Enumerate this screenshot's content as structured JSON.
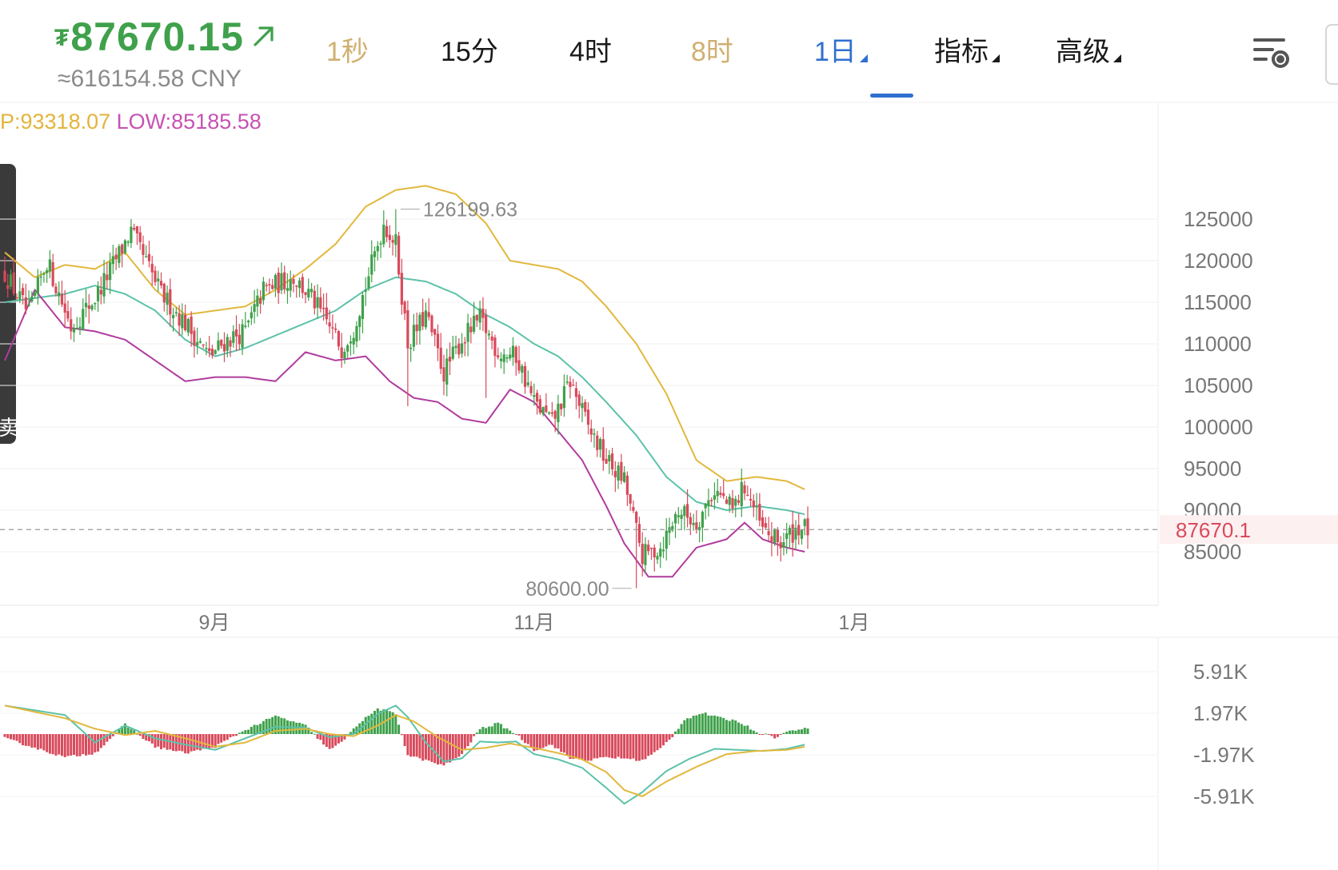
{
  "header": {
    "currency_symbol": "₮",
    "last_price": "87670.15",
    "price_cny": "≈616154.58 CNY",
    "tabs": [
      {
        "label": "1秒",
        "state": "dim",
        "caret": false
      },
      {
        "label": "15分",
        "state": "normal",
        "caret": false
      },
      {
        "label": "4时",
        "state": "normal",
        "caret": false
      },
      {
        "label": "8时",
        "state": "dim",
        "caret": false
      },
      {
        "label": "1日",
        "state": "active",
        "caret": true
      },
      {
        "label": "指标",
        "state": "normal",
        "caret": true
      },
      {
        "label": "高级",
        "state": "normal",
        "caret": true
      }
    ],
    "settings_icon": "chart-settings-icon"
  },
  "hilo": {
    "high": "P:93318.07",
    "low": "LOW:85185.58"
  },
  "side_tab": {
    "label": "卖"
  },
  "colors": {
    "up": "#3fa14b",
    "down": "#d84a5b",
    "mid_band": "#5cc2a9",
    "upper_band": "#e2b83d",
    "lower_band": "#b13c9e",
    "active_tab": "#2f6fd0",
    "dim_tab": "#d0b070",
    "text": "#1a1a1a",
    "axis_text": "#888888",
    "high_text": "#e3b43c",
    "low_text": "#c652b3",
    "current_price_text": "#d84a5b",
    "macd_dif": "#5cc2a9",
    "macd_dea": "#e2b83d"
  },
  "chart_data": [
    {
      "type": "candlestick",
      "title": "",
      "y_axis_ticks": [
        125000,
        120000,
        115000,
        110000,
        105000,
        100000,
        95000,
        90000,
        85000
      ],
      "y_axis_tick_labels": [
        "125000",
        "120000",
        "115000",
        "110000",
        "105000",
        "100000",
        "95000",
        "90000",
        "85000"
      ],
      "ylim": [
        80000,
        132000
      ],
      "x_axis_labels": [
        "9月",
        "11月",
        "1月"
      ],
      "current_price": 87670.15,
      "current_price_label": "87670.1",
      "max_annotation": {
        "value": 126199.63,
        "label": "126199.63"
      },
      "min_annotation": {
        "value": 80600.0,
        "label": "80600.00"
      },
      "overlay": "bollinger bands (upper / middle / lower)",
      "close_path": [
        [
          0,
          118500
        ],
        [
          8,
          113500
        ],
        [
          14,
          120000
        ],
        [
          22,
          112000
        ],
        [
          30,
          115500
        ],
        [
          42,
          123500
        ],
        [
          52,
          116000
        ],
        [
          60,
          112500
        ],
        [
          68,
          108500
        ],
        [
          74,
          110500
        ],
        [
          80,
          111500
        ],
        [
          86,
          116500
        ],
        [
          96,
          118000
        ],
        [
          102,
          115500
        ],
        [
          108,
          112000
        ],
        [
          112,
          109500
        ],
        [
          116,
          112000
        ],
        [
          126,
          124500
        ],
        [
          130,
          122000
        ],
        [
          134,
          110000
        ],
        [
          140,
          113500
        ],
        [
          146,
          106500
        ],
        [
          152,
          110500
        ],
        [
          158,
          113000
        ],
        [
          164,
          109000
        ],
        [
          170,
          108500
        ],
        [
          176,
          103000
        ],
        [
          182,
          100500
        ],
        [
          188,
          105500
        ],
        [
          194,
          100000
        ],
        [
          200,
          96000
        ],
        [
          206,
          93500
        ],
        [
          212,
          84500
        ],
        [
          218,
          85500
        ],
        [
          224,
          90000
        ],
        [
          230,
          88500
        ],
        [
          236,
          92500
        ],
        [
          242,
          90000
        ],
        [
          246,
          93000
        ],
        [
          252,
          87500
        ],
        [
          258,
          86000
        ],
        [
          264,
          88000
        ],
        [
          267,
          87670
        ]
      ],
      "bollinger_upper_path": [
        [
          0,
          121000
        ],
        [
          10,
          118000
        ],
        [
          20,
          119500
        ],
        [
          30,
          119000
        ],
        [
          40,
          121000
        ],
        [
          50,
          116500
        ],
        [
          60,
          113500
        ],
        [
          70,
          114000
        ],
        [
          80,
          114500
        ],
        [
          90,
          116500
        ],
        [
          100,
          119000
        ],
        [
          110,
          122000
        ],
        [
          120,
          126500
        ],
        [
          130,
          128500
        ],
        [
          140,
          129000
        ],
        [
          150,
          128000
        ],
        [
          160,
          124500
        ],
        [
          168,
          120000
        ],
        [
          176,
          119500
        ],
        [
          184,
          119000
        ],
        [
          192,
          117500
        ],
        [
          200,
          114500
        ],
        [
          210,
          110000
        ],
        [
          220,
          104000
        ],
        [
          230,
          96000
        ],
        [
          240,
          93500
        ],
        [
          250,
          94000
        ],
        [
          260,
          93500
        ],
        [
          266,
          92500
        ]
      ],
      "bollinger_mid_path": [
        [
          0,
          115000
        ],
        [
          10,
          115500
        ],
        [
          20,
          116000
        ],
        [
          30,
          117000
        ],
        [
          40,
          116000
        ],
        [
          50,
          114000
        ],
        [
          60,
          110500
        ],
        [
          70,
          108500
        ],
        [
          80,
          109500
        ],
        [
          90,
          111000
        ],
        [
          100,
          112500
        ],
        [
          110,
          114000
        ],
        [
          120,
          116500
        ],
        [
          130,
          118000
        ],
        [
          140,
          117500
        ],
        [
          150,
          116000
        ],
        [
          160,
          113500
        ],
        [
          168,
          112000
        ],
        [
          176,
          110000
        ],
        [
          184,
          108500
        ],
        [
          192,
          106000
        ],
        [
          200,
          103000
        ],
        [
          210,
          99000
        ],
        [
          220,
          94000
        ],
        [
          230,
          91000
        ],
        [
          240,
          90000
        ],
        [
          250,
          90500
        ],
        [
          260,
          90000
        ],
        [
          266,
          89500
        ]
      ],
      "bollinger_lower_path": [
        [
          0,
          108000
        ],
        [
          10,
          116500
        ],
        [
          20,
          112000
        ],
        [
          30,
          111500
        ],
        [
          40,
          110500
        ],
        [
          50,
          108000
        ],
        [
          60,
          105500
        ],
        [
          70,
          106000
        ],
        [
          80,
          106000
        ],
        [
          90,
          105500
        ],
        [
          100,
          109000
        ],
        [
          110,
          108000
        ],
        [
          120,
          108500
        ],
        [
          128,
          105500
        ],
        [
          136,
          103500
        ],
        [
          144,
          103000
        ],
        [
          152,
          101000
        ],
        [
          160,
          100500
        ],
        [
          168,
          104500
        ],
        [
          176,
          103000
        ],
        [
          184,
          99500
        ],
        [
          192,
          96000
        ],
        [
          200,
          90500
        ],
        [
          206,
          86000
        ],
        [
          214,
          82000
        ],
        [
          222,
          82000
        ],
        [
          230,
          85500
        ],
        [
          240,
          86500
        ],
        [
          246,
          88500
        ],
        [
          252,
          86500
        ],
        [
          260,
          85500
        ],
        [
          266,
          85000
        ]
      ]
    },
    {
      "type": "bar",
      "title": "",
      "y_axis_ticks": [
        5910,
        1970,
        -1970,
        -5910
      ],
      "y_axis_tick_labels": [
        "5.91K",
        "1.97K",
        "-1.97K",
        "-5.91K"
      ],
      "ylim": [
        -7500,
        7500
      ],
      "histogram_path": [
        [
          0,
          -400
        ],
        [
          20,
          -2200
        ],
        [
          30,
          -1800
        ],
        [
          40,
          900
        ],
        [
          50,
          -1200
        ],
        [
          60,
          -1800
        ],
        [
          70,
          -1200
        ],
        [
          80,
          400
        ],
        [
          90,
          1700
        ],
        [
          100,
          800
        ],
        [
          108,
          -1500
        ],
        [
          112,
          -800
        ],
        [
          116,
          600
        ],
        [
          124,
          2400
        ],
        [
          130,
          1900
        ],
        [
          134,
          -2000
        ],
        [
          140,
          -2500
        ],
        [
          146,
          -3000
        ],
        [
          152,
          -1900
        ],
        [
          158,
          500
        ],
        [
          164,
          1000
        ],
        [
          170,
          0
        ],
        [
          176,
          -1500
        ],
        [
          182,
          -1000
        ],
        [
          188,
          -2300
        ],
        [
          194,
          -2500
        ],
        [
          200,
          -2200
        ],
        [
          206,
          -2300
        ],
        [
          212,
          -2500
        ],
        [
          218,
          -1400
        ],
        [
          222,
          -200
        ],
        [
          226,
          1400
        ],
        [
          232,
          2000
        ],
        [
          238,
          1500
        ],
        [
          244,
          1200
        ],
        [
          250,
          200
        ],
        [
          256,
          -300
        ],
        [
          262,
          400
        ],
        [
          267,
          500
        ]
      ],
      "dif_path": [
        [
          0,
          2700
        ],
        [
          20,
          1800
        ],
        [
          30,
          -800
        ],
        [
          40,
          800
        ],
        [
          50,
          -400
        ],
        [
          60,
          -1000
        ],
        [
          70,
          -1500
        ],
        [
          80,
          -400
        ],
        [
          90,
          700
        ],
        [
          100,
          600
        ],
        [
          108,
          -300
        ],
        [
          116,
          0
        ],
        [
          124,
          1900
        ],
        [
          130,
          2700
        ],
        [
          134,
          1600
        ],
        [
          140,
          -800
        ],
        [
          146,
          -2600
        ],
        [
          152,
          -2300
        ],
        [
          158,
          -700
        ],
        [
          164,
          -800
        ],
        [
          170,
          -700
        ],
        [
          176,
          -1900
        ],
        [
          184,
          -2400
        ],
        [
          192,
          -3200
        ],
        [
          200,
          -5100
        ],
        [
          206,
          -6600
        ],
        [
          212,
          -5500
        ],
        [
          220,
          -3500
        ],
        [
          228,
          -2300
        ],
        [
          236,
          -1400
        ],
        [
          244,
          -1500
        ],
        [
          252,
          -1600
        ],
        [
          260,
          -1400
        ],
        [
          266,
          -1000
        ]
      ],
      "dea_path": [
        [
          0,
          2700
        ],
        [
          20,
          1500
        ],
        [
          30,
          500
        ],
        [
          40,
          -100
        ],
        [
          50,
          300
        ],
        [
          60,
          -400
        ],
        [
          70,
          -1200
        ],
        [
          80,
          -800
        ],
        [
          90,
          300
        ],
        [
          100,
          500
        ],
        [
          108,
          0
        ],
        [
          116,
          -200
        ],
        [
          124,
          800
        ],
        [
          130,
          1800
        ],
        [
          136,
          1200
        ],
        [
          144,
          -300
        ],
        [
          152,
          -1500
        ],
        [
          160,
          -1300
        ],
        [
          168,
          -900
        ],
        [
          176,
          -1300
        ],
        [
          184,
          -1800
        ],
        [
          192,
          -2400
        ],
        [
          200,
          -3600
        ],
        [
          206,
          -5300
        ],
        [
          212,
          -5900
        ],
        [
          220,
          -4500
        ],
        [
          230,
          -3100
        ],
        [
          240,
          -1900
        ],
        [
          250,
          -1600
        ],
        [
          260,
          -1500
        ],
        [
          266,
          -1200
        ]
      ]
    }
  ]
}
